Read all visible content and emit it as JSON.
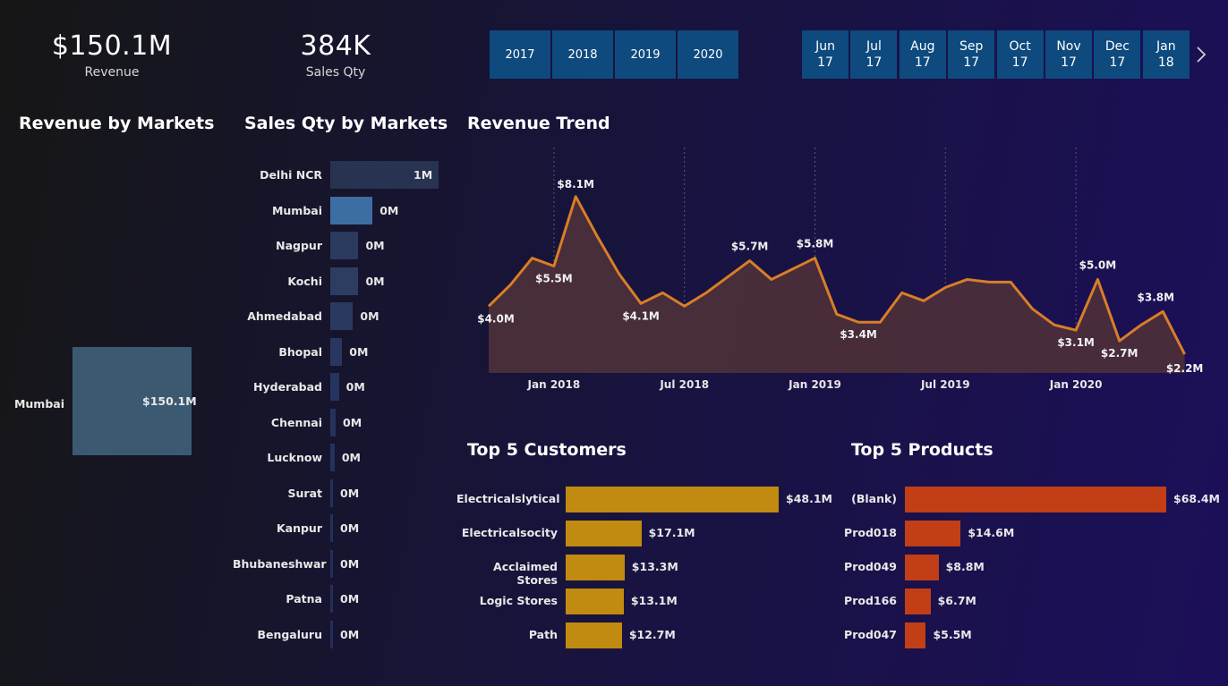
{
  "kpis": {
    "revenue": {
      "value": "$150.1M",
      "label": "Revenue"
    },
    "sales_qty": {
      "value": "384K",
      "label": "Sales Qty"
    }
  },
  "year_slicer": [
    "2017",
    "2018",
    "2019",
    "2020"
  ],
  "month_slicer": [
    {
      "month": "Jun",
      "year": "17"
    },
    {
      "month": "Jul",
      "year": "17"
    },
    {
      "month": "Aug",
      "year": "17"
    },
    {
      "month": "Sep",
      "year": "17"
    },
    {
      "month": "Oct",
      "year": "17"
    },
    {
      "month": "Nov",
      "year": "17"
    },
    {
      "month": "Dec",
      "year": "17"
    },
    {
      "month": "Jan",
      "year": "18"
    }
  ],
  "revenue_by_markets": {
    "title": "Revenue by Markets",
    "category": "Mumbai",
    "value_label": "$150.1M",
    "color": "#3b5a72"
  },
  "sales_qty_by_markets": {
    "title": "Sales Qty by Markets",
    "markets": [
      "Delhi NCR",
      "Mumbai",
      "Nagpur",
      "Kochi",
      "Ahmedabad",
      "Bhopal",
      "Hyderabad",
      "Chennai",
      "Lucknow",
      "Surat",
      "Kanpur",
      "Bhubaneshwar",
      "Patna",
      "Bengaluru"
    ],
    "value_labels": [
      "1M",
      "0M",
      "0M",
      "0M",
      "0M",
      "0M",
      "0M",
      "0M",
      "0M",
      "0M",
      "0M",
      "0M",
      "0M",
      "0M"
    ]
  },
  "revenue_trend": {
    "title": "Revenue Trend",
    "x_ticks": [
      "Jan 2018",
      "Jul 2018",
      "Jan 2019",
      "Jul 2019",
      "Jan 2020"
    ],
    "line_color": "#d97e27",
    "fill_color": "#4b2e3a"
  },
  "top_customers": {
    "title": "Top 5 Customers",
    "labels": [
      "Electricalslytical",
      "Electricalsocity",
      "Acclaimed Stores",
      "Logic Stores",
      "Path"
    ],
    "value_labels": [
      "$48.1M",
      "$17.1M",
      "$13.3M",
      "$13.1M",
      "$12.7M"
    ],
    "color": "#c18a10"
  },
  "top_products": {
    "title": "Top 5 Products",
    "labels": [
      "(Blank)",
      "Prod018",
      "Prod049",
      "Prod166",
      "Prod047"
    ],
    "value_labels": [
      "$68.4M",
      "$14.6M",
      "$8.8M",
      "$6.7M",
      "$5.5M"
    ],
    "color": "#c23e16"
  },
  "chart_data": [
    {
      "type": "bar",
      "title": "Revenue by Markets",
      "categories": [
        "Mumbai"
      ],
      "values": [
        150.1
      ]
    },
    {
      "type": "bar",
      "title": "Sales Qty by Markets",
      "orientation": "horizontal",
      "categories": [
        "Delhi NCR",
        "Mumbai",
        "Nagpur",
        "Kochi",
        "Ahmedabad",
        "Bhopal",
        "Hyderabad",
        "Chennai",
        "Lucknow",
        "Surat",
        "Kanpur",
        "Bhubaneshwar",
        "Patna",
        "Bengaluru"
      ],
      "values": [
        1.0,
        0.39,
        0.26,
        0.26,
        0.21,
        0.11,
        0.08,
        0.05,
        0.04,
        0.02,
        0.02,
        0.02,
        0.01,
        0.01
      ],
      "value_labels": [
        "1M",
        "0M",
        "0M",
        "0M",
        "0M",
        "0M",
        "0M",
        "0M",
        "0M",
        "0M",
        "0M",
        "0M",
        "0M",
        "0M"
      ]
    },
    {
      "type": "area",
      "title": "Revenue Trend",
      "x": [
        "2017-10",
        "2017-11",
        "2017-12",
        "2018-01",
        "2018-02",
        "2018-03",
        "2018-04",
        "2018-05",
        "2018-06",
        "2018-07",
        "2018-08",
        "2018-09",
        "2018-10",
        "2018-11",
        "2018-12",
        "2019-01",
        "2019-02",
        "2019-03",
        "2019-04",
        "2019-05",
        "2019-06",
        "2019-07",
        "2019-08",
        "2019-09",
        "2019-10",
        "2019-11",
        "2019-12",
        "2020-01",
        "2020-02",
        "2020-03",
        "2020-04",
        "2020-05",
        "2020-06"
      ],
      "y": [
        4.0,
        4.8,
        5.8,
        5.5,
        8.1,
        6.6,
        5.2,
        4.1,
        4.5,
        4.0,
        4.5,
        5.1,
        5.7,
        5.0,
        5.4,
        5.8,
        3.7,
        3.4,
        3.4,
        4.5,
        4.2,
        4.7,
        5.0,
        4.9,
        4.9,
        3.9,
        3.3,
        3.1,
        5.0,
        2.7,
        3.3,
        3.8,
        2.2
      ],
      "point_labels": {
        "0": "$4.0M",
        "3": "$5.5M",
        "4": "$8.1M",
        "7": "$4.1M",
        "12": "$5.7M",
        "15": "$5.8M",
        "17": "$3.4M",
        "27": "$3.1M",
        "28": "$5.0M",
        "29": "$2.7M",
        "31": "$3.8M",
        "32": "$2.2M"
      },
      "x_ticks": [
        "Jan 2018",
        "Jul 2018",
        "Jan 2019",
        "Jul 2019",
        "Jan 2020"
      ],
      "ylim": [
        1.5,
        9.5
      ],
      "grid": "vertical-dotted"
    },
    {
      "type": "bar",
      "title": "Top 5 Customers",
      "orientation": "horizontal",
      "categories": [
        "Electricalslytical",
        "Electricalsocity",
        "Acclaimed Stores",
        "Logic Stores",
        "Path"
      ],
      "values": [
        48.1,
        17.1,
        13.3,
        13.1,
        12.7
      ]
    },
    {
      "type": "bar",
      "title": "Top 5 Products",
      "orientation": "horizontal",
      "categories": [
        "(Blank)",
        "Prod018",
        "Prod049",
        "Prod166",
        "Prod047"
      ],
      "values": [
        68.4,
        14.6,
        8.8,
        6.7,
        5.5
      ]
    }
  ]
}
